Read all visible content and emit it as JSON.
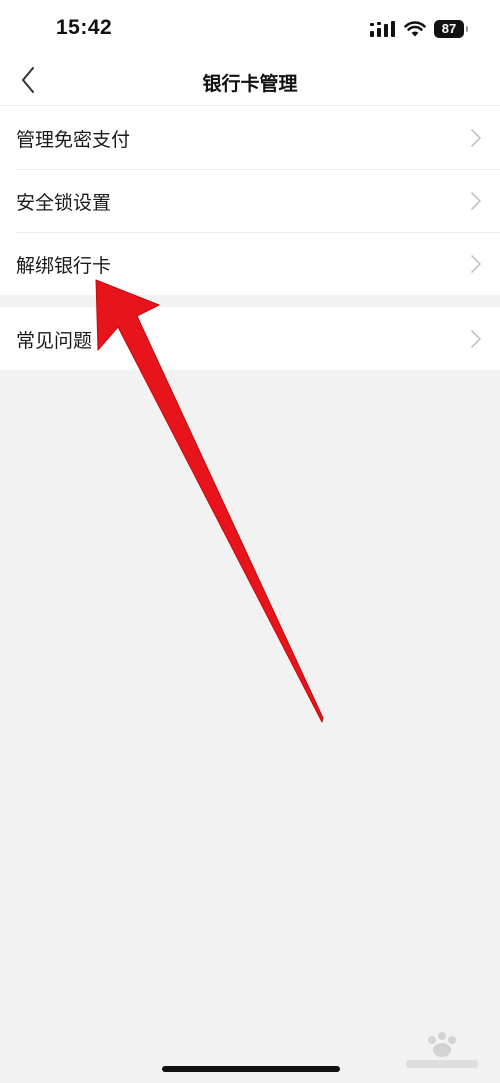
{
  "status_bar": {
    "time": "15:42",
    "battery_level": "87",
    "icons": [
      "cellular-signal-icon",
      "wifi-icon",
      "battery-icon"
    ]
  },
  "nav": {
    "title": "银行卡管理",
    "back_icon": "chevron-left-icon"
  },
  "menu_groups": [
    {
      "items": [
        {
          "label": "管理免密支付",
          "icon": "chevron-right-icon"
        },
        {
          "label": "安全锁设置",
          "icon": "chevron-right-icon"
        },
        {
          "label": "解绑银行卡",
          "icon": "chevron-right-icon"
        }
      ]
    },
    {
      "items": [
        {
          "label": "常见问题",
          "icon": "chevron-right-icon"
        }
      ]
    }
  ],
  "annotation": {
    "icon": "red-arrow-annotation",
    "color": "#e8141b",
    "points_to": "解绑银行卡"
  },
  "colors": {
    "background": "#f2f2f2",
    "surface": "#ffffff",
    "divider": "#ececec",
    "chevron": "#c4c4c4"
  }
}
